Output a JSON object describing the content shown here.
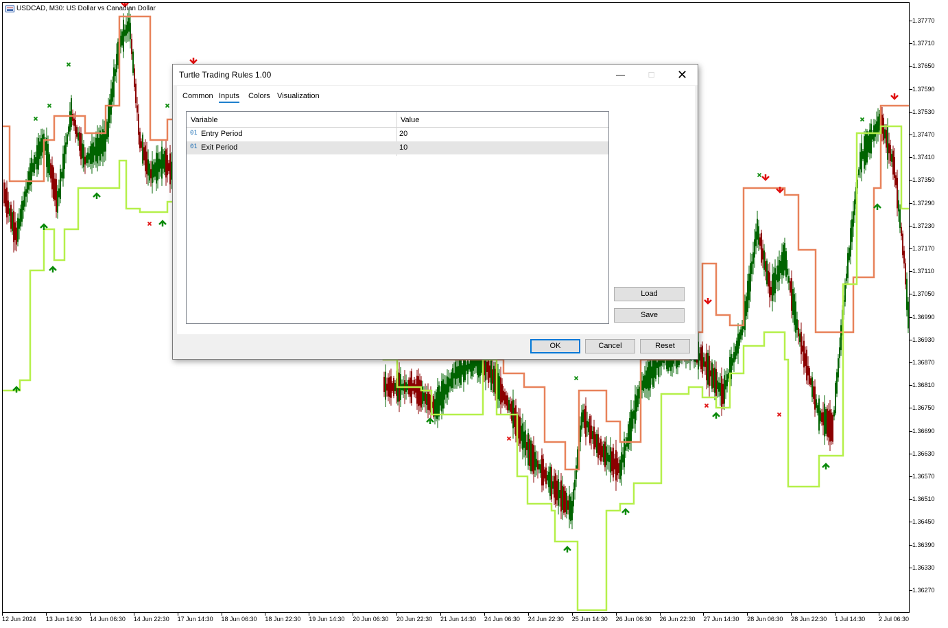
{
  "chart": {
    "title": "USDCAD, M30:  US Dollar vs Canadian Dollar",
    "icon": "chart-window-icon",
    "colors": {
      "bull": "#006400",
      "bear": "#8b0000",
      "upper_channel": "#e8825a",
      "lower_channel": "#b5f04a",
      "buy_arrow": "#0a8a0a",
      "sell_arrow": "#e01010",
      "entry_dot": "#3a8fd0"
    },
    "y_labels": [
      "1.37770",
      "1.37710",
      "1.37650",
      "1.37590",
      "1.37530",
      "1.37470",
      "1.37410",
      "1.37350",
      "1.37290",
      "1.37230",
      "1.37170",
      "1.37110",
      "1.37050",
      "1.36990",
      "1.36930",
      "1.36870",
      "1.36810",
      "1.36750",
      "1.36690",
      "1.36630",
      "1.36570",
      "1.36510",
      "1.36450",
      "1.36390",
      "1.36330",
      "1.36270"
    ],
    "x_labels": [
      "12 Jun 2024",
      "13 Jun 14:30",
      "14 Jun 06:30",
      "14 Jun 22:30",
      "17 Jun 14:30",
      "18 Jun 06:30",
      "18 Jun 22:30",
      "19 Jun 14:30",
      "20 Jun 06:30",
      "20 Jun 22:30",
      "21 Jun 14:30",
      "24 Jun 06:30",
      "24 Jun 22:30",
      "25 Jun 14:30",
      "26 Jun 06:30",
      "26 Jun 22:30",
      "27 Jun 14:30",
      "28 Jun 06:30",
      "28 Jun 22:30",
      "1 Jul 14:30",
      "2 Jul 06:30"
    ]
  },
  "dialog": {
    "title": "Turtle Trading Rules 1.00",
    "tabs": [
      "Common",
      "Inputs",
      "Colors",
      "Visualization"
    ],
    "active_tab": "Inputs",
    "grid": {
      "headers": [
        "Variable",
        "Value"
      ],
      "rows": [
        {
          "type_icon": "01",
          "name": "Entry Period",
          "value": "20"
        },
        {
          "type_icon": "01",
          "name": "Exit Period",
          "value": "10"
        }
      ]
    },
    "side_buttons": {
      "load": "Load",
      "save": "Save"
    },
    "footer_buttons": {
      "ok": "OK",
      "cancel": "Cancel",
      "reset": "Reset"
    }
  }
}
